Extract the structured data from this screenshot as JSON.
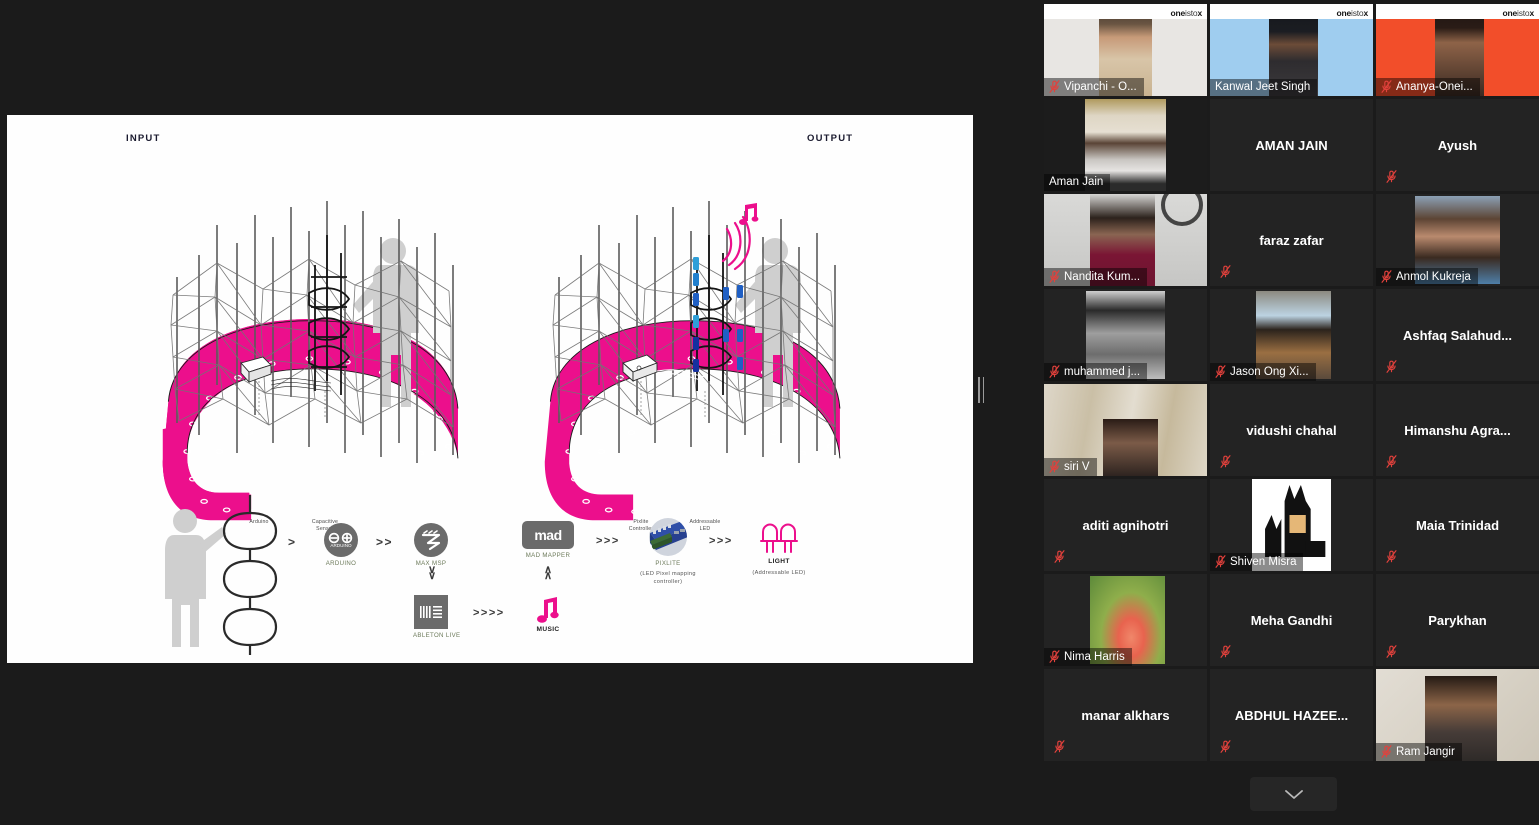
{
  "app": {
    "name": "zoom-meeting",
    "background": "#1b1b1b"
  },
  "shared_screen": {
    "name": "shared-presentation-slide",
    "labels": {
      "input": "INPUT",
      "output": "OUTPUT"
    },
    "input_callouts": [
      {
        "text_line1": "Arduino",
        "text_line2": ""
      },
      {
        "text_line1": "Capacitive",
        "text_line2": "Sensor"
      }
    ],
    "output_callouts": [
      {
        "text_line1": "Pixlite",
        "text_line2": "Controller"
      },
      {
        "text_line1": "Addressable",
        "text_line2": "LED"
      }
    ],
    "workflow": {
      "nodes": [
        {
          "id": "person-module",
          "caption": "",
          "sub": ""
        },
        {
          "id": "arduino",
          "caption": "ARDUINO",
          "sub": ""
        },
        {
          "id": "max-msp",
          "caption": "MAX MSP",
          "sub": ""
        },
        {
          "id": "mad-mapper",
          "caption": "MAD MAPPER",
          "sub": "",
          "logo_text": "mad"
        },
        {
          "id": "ableton-live",
          "caption": "ABLETON LIVE",
          "sub": ""
        },
        {
          "id": "music",
          "caption": "MUSIC",
          "sub": ""
        },
        {
          "id": "pixlite",
          "caption": "PIXLITE",
          "sub": "(LED Pixel mapping controller)"
        },
        {
          "id": "light",
          "caption": "LIGHT",
          "sub": "(Addressable LED)"
        }
      ],
      "arrows": [
        ">",
        ">>",
        ">>>",
        ">>>",
        ">>>>",
        "v v",
        "^ ^"
      ]
    },
    "accent_color": "#ec0f8c",
    "led_color": "#1f5fc4"
  },
  "participants": [
    {
      "name": "Vipanchi - O...",
      "muted": true,
      "video": true,
      "label_style": "bar",
      "avatar": "person-light-bg",
      "brand_logo": "oneistox",
      "active": false
    },
    {
      "name": "Kanwal Jeet Singh",
      "muted": false,
      "video": true,
      "label_style": "bar",
      "avatar": "person-blue-bg",
      "brand_logo": "oneistox",
      "active": false
    },
    {
      "name": "Ananya-Onei...",
      "muted": true,
      "video": true,
      "label_style": "bar",
      "avatar": "person-orange-bg",
      "brand_logo": "oneistox",
      "active": false
    },
    {
      "name": "Aman Jain",
      "muted": false,
      "video": true,
      "label_style": "bar",
      "avatar": "person-room",
      "brand_logo": "",
      "active": true
    },
    {
      "name": "AMAN JAIN",
      "muted": false,
      "video": false,
      "label_style": "center",
      "avatar": "",
      "brand_logo": "",
      "active": false
    },
    {
      "name": "Ayush",
      "muted": true,
      "video": false,
      "label_style": "center",
      "avatar": "",
      "brand_logo": "",
      "active": false
    },
    {
      "name": "Nandita Kum...",
      "muted": true,
      "video": true,
      "label_style": "bar",
      "avatar": "person-brick",
      "brand_logo": "",
      "active": false
    },
    {
      "name": "faraz zafar",
      "muted": true,
      "video": false,
      "label_style": "center",
      "avatar": "",
      "brand_logo": "",
      "active": false
    },
    {
      "name": "Anmol Kukreja",
      "muted": true,
      "video": true,
      "label_style": "bar",
      "avatar": "photo-portrait",
      "brand_logo": "",
      "active": false
    },
    {
      "name": "muhammed j...",
      "muted": true,
      "video": true,
      "label_style": "bar",
      "avatar": "photo-bw-man",
      "brand_logo": "",
      "active": false
    },
    {
      "name": "Jason Ong Xi...",
      "muted": true,
      "video": true,
      "label_style": "bar",
      "avatar": "photo-street",
      "brand_logo": "",
      "active": false
    },
    {
      "name": "Ashfaq  Salahud...",
      "muted": true,
      "video": false,
      "label_style": "center",
      "avatar": "",
      "brand_logo": "",
      "active": false
    },
    {
      "name": "siri V",
      "muted": true,
      "video": true,
      "label_style": "bar",
      "avatar": "person-curtain",
      "brand_logo": "",
      "active": false
    },
    {
      "name": "vidushi chahal",
      "muted": true,
      "video": false,
      "label_style": "center",
      "avatar": "",
      "brand_logo": "",
      "active": false
    },
    {
      "name": "Himanshu  Agra...",
      "muted": true,
      "video": false,
      "label_style": "center",
      "avatar": "",
      "brand_logo": "",
      "active": false
    },
    {
      "name": "aditi agnihotri",
      "muted": true,
      "video": false,
      "label_style": "center",
      "avatar": "",
      "brand_logo": "",
      "active": false
    },
    {
      "name": "Shiven Misra",
      "muted": true,
      "video": true,
      "label_style": "bar",
      "avatar": "photo-batman",
      "brand_logo": "",
      "active": false
    },
    {
      "name": "Maia Trinidad",
      "muted": true,
      "video": false,
      "label_style": "center",
      "avatar": "",
      "brand_logo": "",
      "active": false
    },
    {
      "name": "Nima Harris",
      "muted": true,
      "video": true,
      "label_style": "bar",
      "avatar": "photo-tulip",
      "brand_logo": "",
      "active": false
    },
    {
      "name": "Meha Gandhi",
      "muted": true,
      "video": false,
      "label_style": "center",
      "avatar": "",
      "brand_logo": "",
      "active": false
    },
    {
      "name": "Parykhan",
      "muted": true,
      "video": false,
      "label_style": "center",
      "avatar": "",
      "brand_logo": "",
      "active": false
    },
    {
      "name": "manar alkhars",
      "muted": true,
      "video": false,
      "label_style": "center",
      "avatar": "",
      "brand_logo": "",
      "active": false
    },
    {
      "name": "ABDHUL  HAZEE...",
      "muted": true,
      "video": false,
      "label_style": "center",
      "avatar": "",
      "brand_logo": "",
      "active": false
    },
    {
      "name": "Ram Jangir",
      "muted": true,
      "video": true,
      "label_style": "bar",
      "avatar": "person-wall",
      "brand_logo": "",
      "active": false
    }
  ],
  "brand": {
    "logo_part1": "one",
    "logo_part2": "isto",
    "logo_part3": "x"
  },
  "controls": {
    "scroll_down_label": "chevron-down-icon",
    "drag_handle_label": "resize-handle"
  },
  "colors": {
    "active_speaker_border": "#d9e34b",
    "mic_off": "#e2413c",
    "tile_bg": "#232323",
    "page_bg": "#1b1b1b",
    "magenta": "#ec0f8c"
  }
}
